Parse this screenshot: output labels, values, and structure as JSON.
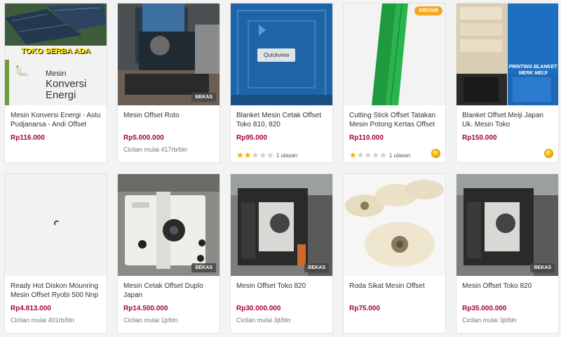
{
  "products": [
    {
      "title": "Mesin Konversi Energi - Astu Pudjanarsa - Andi Offset",
      "price": "Rp116.000",
      "installment": "",
      "badge": "",
      "rating": null,
      "reviews": "",
      "medal": false,
      "image": {
        "headline": "TOKO SERBA ADA",
        "book_title_1": "Mesin",
        "book_title_2": "Konversi",
        "book_title_3": "Energi"
      }
    },
    {
      "title": "Mesin Offset Roto",
      "price": "Rp5.000.000",
      "installment": "Cicilan mulai 417rb/bln",
      "badge": "BEKAS",
      "rating": null,
      "reviews": "",
      "medal": false
    },
    {
      "title": "Blanket Mesin Cetak Offset Toko 810, 820",
      "price": "Rp95.000",
      "installment": "",
      "badge": "",
      "rating": 2,
      "reviews": "1 ulasan",
      "medal": false,
      "quickview": "Quickview"
    },
    {
      "title": "Cutting Stick Offset Tatakan Mesin Potong Kertas Offset",
      "price": "Rp110.000",
      "installment": "",
      "badge": "GROSIR",
      "rating": 1,
      "reviews": "1 ulasan",
      "medal": true
    },
    {
      "title": "Blanket Offset Meiji Japan Uk. Mesin Toko",
      "price": "Rp150.000",
      "installment": "",
      "badge": "",
      "rating": null,
      "reviews": "",
      "medal": true,
      "image": {
        "caption": "PRINTING BLANKET MERK MEIJI"
      }
    },
    {
      "title": "Ready Hot Diskon Mounring Mesin Offset Ryobi 500 Nnp",
      "price": "Rp4.813.000",
      "installment": "Cicilan mulai 401rb/bln",
      "badge": "",
      "rating": null,
      "reviews": "",
      "medal": false
    },
    {
      "title": "Mesin Cetak Offset Duplo Japan",
      "price": "Rp14.500.000",
      "installment": "Cicilan mulai 1jt/bln",
      "badge": "BEKAS",
      "rating": null,
      "reviews": "",
      "medal": false
    },
    {
      "title": "Mesin Offset Toko 820",
      "price": "Rp30.000.000",
      "installment": "Cicilan mulai 3jt/bln",
      "badge": "BEKAS",
      "rating": null,
      "reviews": "",
      "medal": false
    },
    {
      "title": "Roda Sikat Mesin Offset",
      "price": "Rp75.000",
      "installment": "",
      "badge": "",
      "rating": null,
      "reviews": "",
      "medal": false
    },
    {
      "title": "Mesin Offset Toko 820",
      "price": "Rp35.000.000",
      "installment": "Cicilan mulai 3jt/bln",
      "badge": "BEKAS",
      "rating": null,
      "reviews": "",
      "medal": false
    }
  ],
  "colors": {
    "price": "#a8003c",
    "star": "#f0b000",
    "grosir": "#f5a623"
  }
}
